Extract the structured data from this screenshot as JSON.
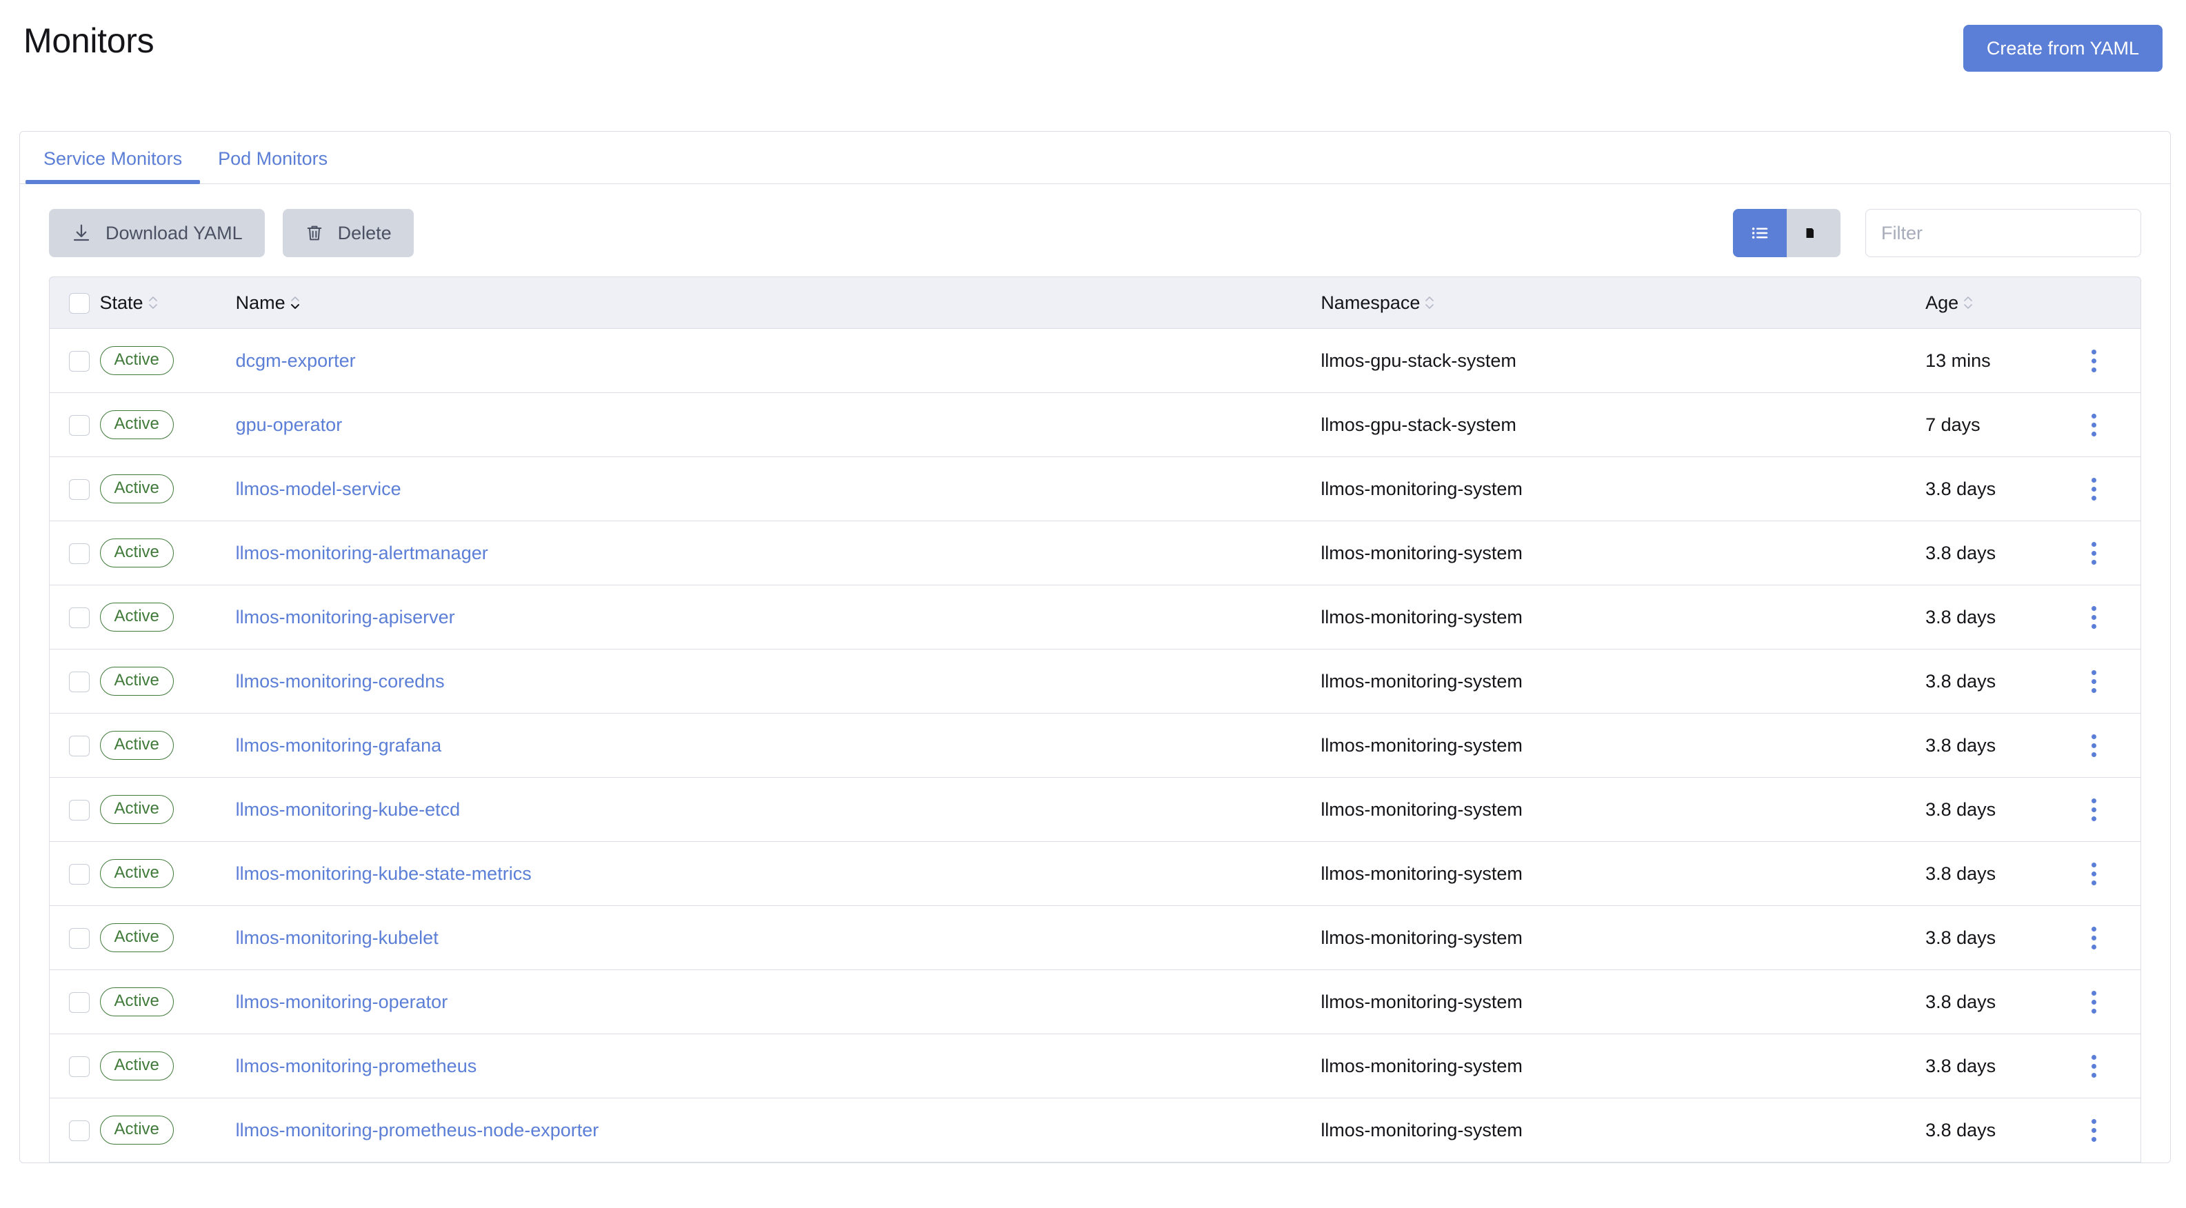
{
  "header": {
    "title": "Monitors",
    "create_button": "Create from YAML"
  },
  "tabs": [
    {
      "label": "Service Monitors",
      "active": true
    },
    {
      "label": "Pod Monitors",
      "active": false
    }
  ],
  "toolbar": {
    "download_label": "Download YAML",
    "delete_label": "Delete",
    "download_icon": "download-icon",
    "delete_icon": "trash-icon",
    "view_list_icon": "list-view-icon",
    "view_group_icon": "folder-view-icon",
    "view_active": "list",
    "filter_placeholder": "Filter",
    "filter_value": ""
  },
  "table": {
    "columns": [
      {
        "key": "state",
        "label": "State",
        "sortable": true,
        "sorted": "none"
      },
      {
        "key": "name",
        "label": "Name",
        "sortable": true,
        "sorted": "asc"
      },
      {
        "key": "namespace",
        "label": "Namespace",
        "sortable": true,
        "sorted": "none"
      },
      {
        "key": "age",
        "label": "Age",
        "sortable": true,
        "sorted": "none"
      }
    ],
    "rows": [
      {
        "state": "Active",
        "name": "dcgm-exporter",
        "namespace": "llmos-gpu-stack-system",
        "age": "13 mins",
        "selected": false
      },
      {
        "state": "Active",
        "name": "gpu-operator",
        "namespace": "llmos-gpu-stack-system",
        "age": "7 days",
        "selected": false
      },
      {
        "state": "Active",
        "name": "llmos-model-service",
        "namespace": "llmos-monitoring-system",
        "age": "3.8 days",
        "selected": false
      },
      {
        "state": "Active",
        "name": "llmos-monitoring-alertmanager",
        "namespace": "llmos-monitoring-system",
        "age": "3.8 days",
        "selected": false
      },
      {
        "state": "Active",
        "name": "llmos-monitoring-apiserver",
        "namespace": "llmos-monitoring-system",
        "age": "3.8 days",
        "selected": false
      },
      {
        "state": "Active",
        "name": "llmos-monitoring-coredns",
        "namespace": "llmos-monitoring-system",
        "age": "3.8 days",
        "selected": false
      },
      {
        "state": "Active",
        "name": "llmos-monitoring-grafana",
        "namespace": "llmos-monitoring-system",
        "age": "3.8 days",
        "selected": false
      },
      {
        "state": "Active",
        "name": "llmos-monitoring-kube-etcd",
        "namespace": "llmos-monitoring-system",
        "age": "3.8 days",
        "selected": false
      },
      {
        "state": "Active",
        "name": "llmos-monitoring-kube-state-metrics",
        "namespace": "llmos-monitoring-system",
        "age": "3.8 days",
        "selected": false
      },
      {
        "state": "Active",
        "name": "llmos-monitoring-kubelet",
        "namespace": "llmos-monitoring-system",
        "age": "3.8 days",
        "selected": false
      },
      {
        "state": "Active",
        "name": "llmos-monitoring-operator",
        "namespace": "llmos-monitoring-system",
        "age": "3.8 days",
        "selected": false
      },
      {
        "state": "Active",
        "name": "llmos-monitoring-prometheus",
        "namespace": "llmos-monitoring-system",
        "age": "3.8 days",
        "selected": false
      },
      {
        "state": "Active",
        "name": "llmos-monitoring-prometheus-node-exporter",
        "namespace": "llmos-monitoring-system",
        "age": "3.8 days",
        "selected": false
      }
    ]
  },
  "colors": {
    "accent": "#5b7ed6",
    "badge_green": "#3f7a39",
    "secondary_button": "#d3d7e0",
    "border": "#dcdee7",
    "header_row": "#eef0f6"
  }
}
